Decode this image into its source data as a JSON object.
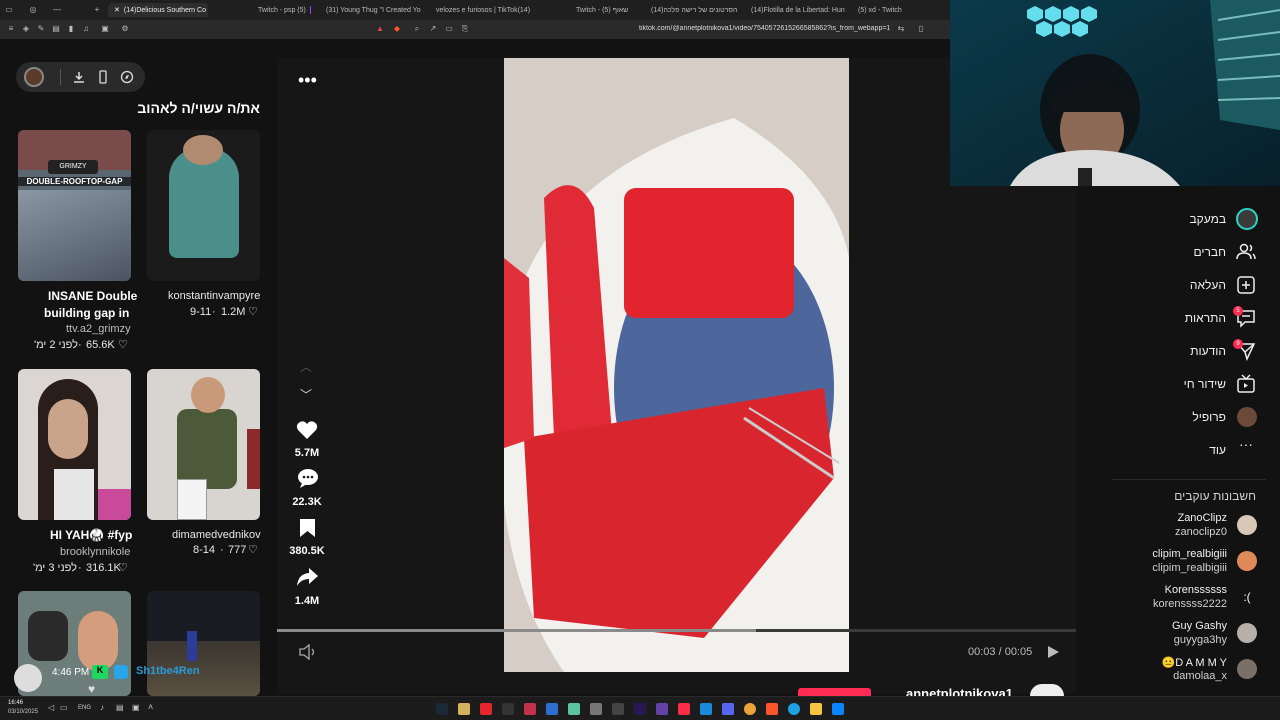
{
  "browser": {
    "tabs": [
      {
        "label": "(14)Delicious Southern Co",
        "active": true
      },
      {
        "label": "Twitch - psp (5)"
      },
      {
        "label": "(31) Young Thug \"I Created Yo"
      },
      {
        "label": "velozes e furiosos | TikTok(14)"
      },
      {
        "label": "Twitch - שאוף (5)"
      },
      {
        "label": "(14)הסרטונים של רישה פלכה"
      },
      {
        "label": "(14)Flotilla de la Libertad: Hun"
      },
      {
        "label": "(5) xd - Twitch"
      }
    ],
    "url": "tiktok.com/@annetplotnikova1/video/7540572615266585862?is_from_webapp=1"
  },
  "left_panel": {
    "heading": "את/ה עשוי/ה לאהוב",
    "cards": [
      {
        "thumb_text": "DOUBLE-ROOFTOP-GAP",
        "thumb_logo": "GRIMZY",
        "title_line1": "INSANE Double",
        "title_line2": "building gap in",
        "author": "ttv.a2_grimzy",
        "time": "לפני 2 ימ'",
        "likes": "65.6K"
      },
      {
        "author": "konstantinvampyre",
        "date": "9-11",
        "likes": "1.2M"
      },
      {
        "title": "HI YAH🥋 #fyp",
        "author": "brooklynnikole",
        "time": "לפני 3 ימ'",
        "likes": "316.1K"
      },
      {
        "author": "dimamedvednikov",
        "date": "8-14",
        "likes": "777"
      }
    ]
  },
  "video": {
    "actions": [
      {
        "icon": "heart-icon",
        "count": "5.7M"
      },
      {
        "icon": "comment-icon",
        "count": "22.3K"
      },
      {
        "icon": "bookmark-icon",
        "count": "380.5K"
      },
      {
        "icon": "share-icon",
        "count": "1.4M"
      }
    ],
    "progress": 0.6,
    "time": "00:03 / 00:05",
    "author_handle": "annetplotnikova1"
  },
  "nav": {
    "items": [
      {
        "label": "במעקב",
        "icon": "following-avatar-icon"
      },
      {
        "label": "חברים",
        "icon": "friends-icon"
      },
      {
        "label": "העלאה",
        "icon": "upload-icon"
      },
      {
        "label": "התראות",
        "icon": "inbox-icon",
        "badge": "5"
      },
      {
        "label": "הודעות",
        "icon": "messages-icon",
        "badge": "9"
      },
      {
        "label": "שידור חי",
        "icon": "live-icon"
      },
      {
        "label": "פרופיל",
        "icon": "profile-avatar-icon"
      },
      {
        "label": "עוד",
        "icon": "more-icon"
      }
    ],
    "following_heading": "חשבונות עוקבים",
    "accounts": [
      {
        "name": "ZanoClipz",
        "handle": "zanoclipz0"
      },
      {
        "name": "clipim_realbigiii",
        "handle": "clipim_realbigiii"
      },
      {
        "name": "Korenssssss",
        "handle": "korenssss2222"
      },
      {
        "name": "Guy Gashy",
        "handle": "guyyga3hy"
      },
      {
        "name": "😐D A M M Y",
        "handle": "damolaa_x"
      }
    ]
  },
  "overlay": {
    "time": "4:46 PM",
    "name": "Sh1tbe4Ren"
  },
  "taskbar": {
    "time": "16:46",
    "date": "03/10/2025",
    "lang": "ENG"
  },
  "colors": {
    "accent": "#fe2c55",
    "background": "#121212"
  }
}
